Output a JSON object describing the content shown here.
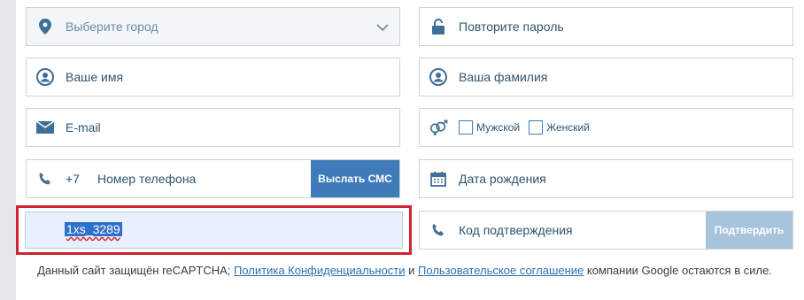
{
  "form": {
    "city": {
      "placeholder": "Выберите город"
    },
    "repeat_password": {
      "placeholder": "Повторите пароль"
    },
    "first_name": {
      "placeholder": "Ваше имя"
    },
    "last_name": {
      "placeholder": "Ваша фамилия"
    },
    "email": {
      "placeholder": "E-mail"
    },
    "gender": {
      "male_label": "Мужской",
      "female_label": "Женский"
    },
    "phone": {
      "prefix": "+7",
      "placeholder": "Номер телефона",
      "send_sms_label": "Выслать СМС"
    },
    "birth_date": {
      "placeholder": "Дата рождения"
    },
    "promo": {
      "value": "1xs_3289"
    },
    "confirm_code": {
      "placeholder": "Код подтверждения",
      "confirm_label": "Подтвердить"
    }
  },
  "footer": {
    "text_before": "Данный сайт защищён reCAPTCHA; ",
    "privacy_link": "Политика Конфиденциальности",
    "and": " и ",
    "terms_link": "Пользовательское соглашение",
    "text_after": " компании Google остаются в силе."
  },
  "colors": {
    "accent": "#3f7bb8",
    "highlight": "#d0232f",
    "disabled_button": "#a8c4dc"
  }
}
